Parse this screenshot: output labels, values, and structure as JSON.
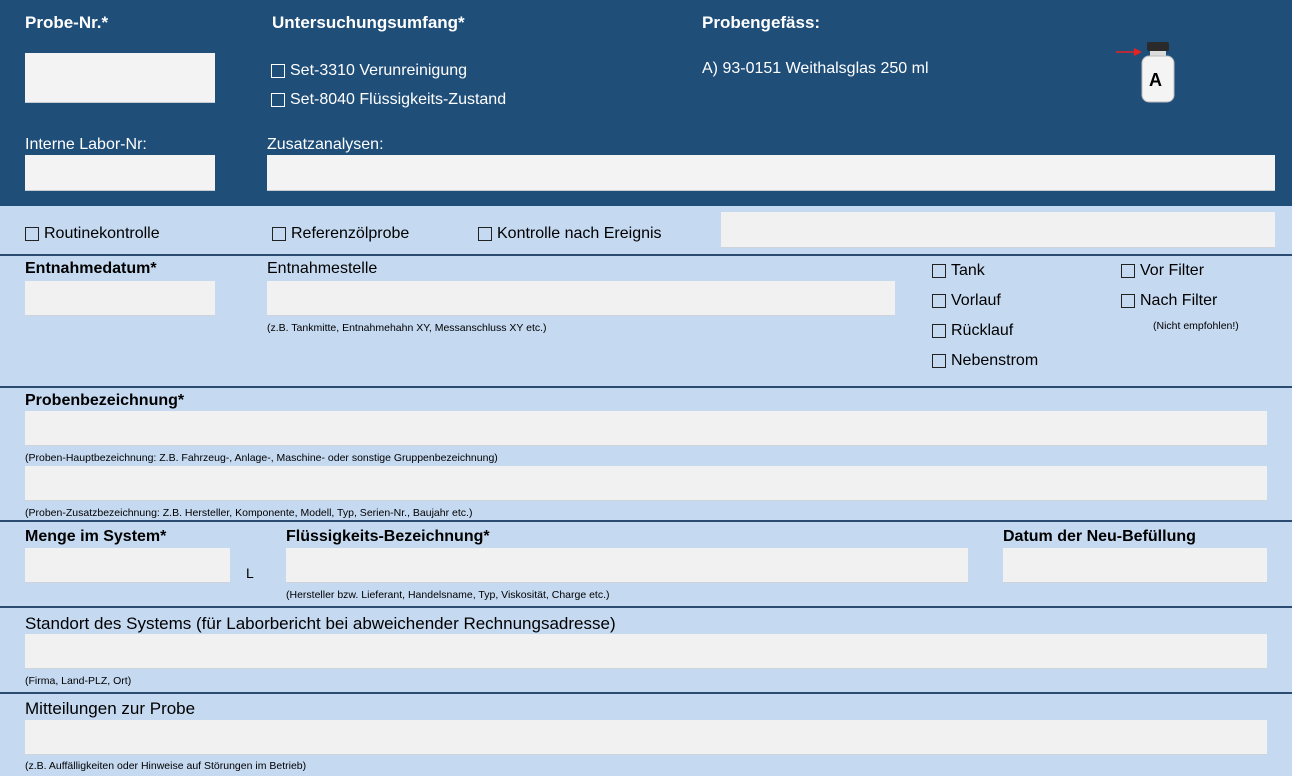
{
  "top": {
    "probe_nr_label": "Probe-Nr.*",
    "untersuchungsumfang_label": "Untersuchungsumfang*",
    "probengefaess_label": "Probengefäss:",
    "set_3310": "Set-3310 Verunreinigung",
    "set_8040": "Set-8040 Flüssigkeits-Zustand",
    "container_a": "A) 93-0151 Weithalsglas 250 ml",
    "jar_letter": "A",
    "interne_labor_label": "Interne Labor-Nr:",
    "zusatzanalysen_label": "Zusatzanalysen:"
  },
  "reason": {
    "routine": "Routinekontrolle",
    "referenz": "Referenzölprobe",
    "ereignis": "Kontrolle nach Ereignis"
  },
  "sampling": {
    "datum_label": "Entnahmedatum*",
    "stelle_label": "Entnahmestelle",
    "stelle_hint": "(z.B. Tankmitte, Entnahmehahn XY, Messanschluss XY etc.)",
    "tank": "Tank",
    "vorlauf": "Vorlauf",
    "ruecklauf": "Rücklauf",
    "nebenstrom": "Nebenstrom",
    "vor_filter": "Vor Filter",
    "nach_filter": "Nach Filter",
    "nach_filter_hint": "(Nicht empfohlen!)"
  },
  "designation": {
    "label": "Probenbezeichnung*",
    "main_hint": "(Proben-Hauptbezeichnung: Z.B. Fahrzeug-, Anlage-, Maschine- oder sonstige Gruppenbezeichnung)",
    "extra_hint": "(Proben-Zusatzbezeichnung: Z.B. Hersteller, Komponente, Modell, Typ, Serien-Nr., Baujahr etc.)"
  },
  "fluid": {
    "menge_label": "Menge im System*",
    "unit": "L",
    "bezeichnung_label": "Flüssigkeits-Bezeichnung*",
    "bezeichnung_hint": "(Hersteller bzw. Lieferant, Handelsname, Typ, Viskosität, Charge etc.)",
    "neu_befuellung_label": "Datum der Neu-Befüllung"
  },
  "location": {
    "label": "Standort des Systems (für Laborbericht bei abweichender Rechnungsadresse)",
    "hint": "(Firma, Land-PLZ, Ort)"
  },
  "notes": {
    "label": "Mitteilungen zur Probe",
    "hint": "(z.B. Auffälligkeiten oder Hinweise auf Störungen im Betrieb)"
  },
  "colors": {
    "header_bg": "#1f4e79",
    "section_bg": "#c5d9f1",
    "field_bg": "#f1f1f1",
    "jar_arrow": "#e32222"
  }
}
